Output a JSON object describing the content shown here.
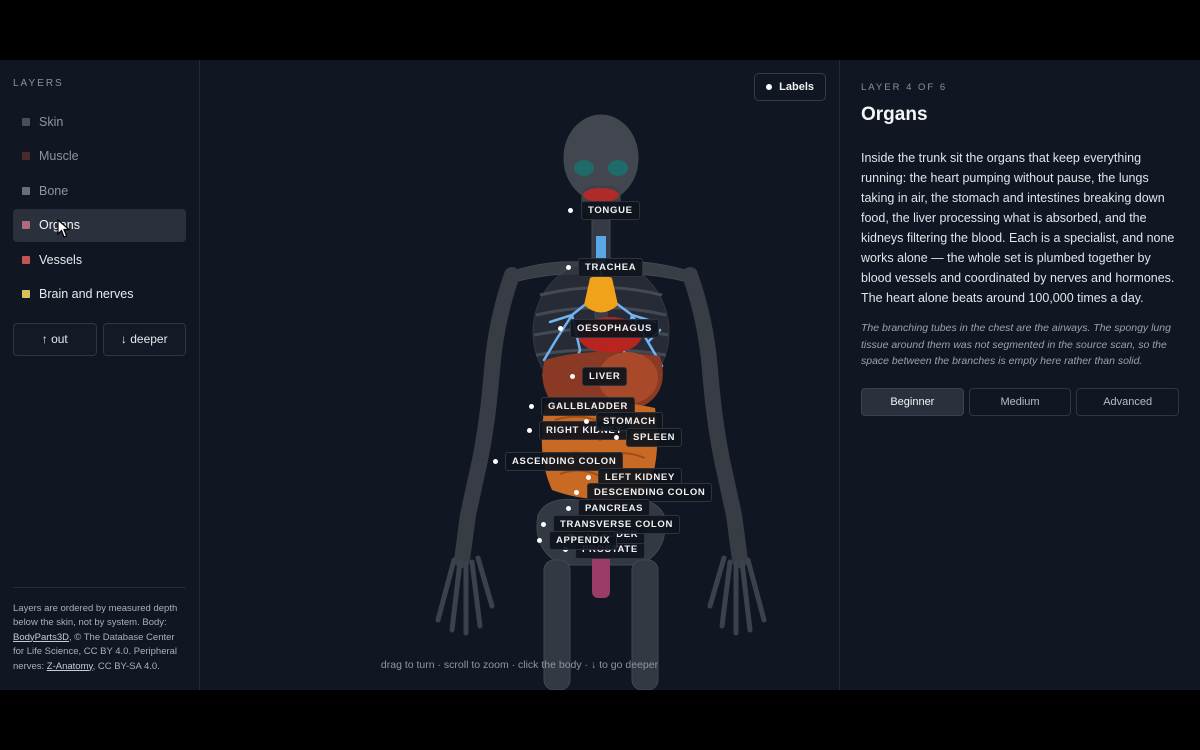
{
  "sidebar": {
    "title": "LAYERS",
    "layers": [
      {
        "label": "Skin",
        "color": "#4a4f57"
      },
      {
        "label": "Muscle",
        "color": "#4a2a2a"
      },
      {
        "label": "Bone",
        "color": "#6a6e75"
      },
      {
        "label": "Organs",
        "color": "#b06a7e"
      },
      {
        "label": "Vessels",
        "color": "#c25454"
      },
      {
        "label": "Brain and nerves",
        "color": "#d6c25a"
      }
    ],
    "out_label": "↑ out",
    "deeper_label": "↓ deeper",
    "footer": {
      "line1": "Layers are ordered by measured depth below the skin, not by system. Body: ",
      "link1": "BodyParts3D",
      "line2": ", © The Database Center for Life Science, CC BY 4.0. Peripheral nerves: ",
      "link2": "Z-Anatomy",
      "line3": ", CC BY-SA 4.0."
    }
  },
  "viewport": {
    "labels_button": "Labels",
    "hint": "drag to turn · scroll to zoom · click the body · ↓ to go deeper",
    "organ_labels": {
      "tongue": "TONGUE",
      "trachea": "TRACHEA",
      "oesophagus": "OESOPHAGUS",
      "liver": "LIVER",
      "gallbladder": "GALLBLADDER",
      "stomach": "STOMACH",
      "right_kidney": "RIGHT KIDNEY",
      "spleen": "SPLEEN",
      "ascending_colon": "ASCENDING COLON",
      "left_kidney": "LEFT KIDNEY",
      "descending_colon": "DESCENDING COLON",
      "pancreas": "PANCREAS",
      "transverse_colon": "TRANSVERSE COLON",
      "bladder": "BLADDER",
      "appendix": "APPENDIX",
      "prostate": "PROSTATE"
    }
  },
  "panel": {
    "step": "LAYER 4 OF 6",
    "title": "Organs",
    "body": "Inside the trunk sit the organs that keep everything running: the heart pumping without pause, the lungs taking in air, the stomach and intestines breaking down food, the liver processing what is absorbed, and the kidneys filtering the blood. Each is a specialist, and none works alone — the whole set is plumbed together by blood vessels and coordinated by nerves and hormones. The heart alone beats around 100,000 times a day.",
    "note": "The branching tubes in the chest are the airways. The spongy lung tissue around them was not segmented in the source scan, so the space between the branches is empty here rather than solid.",
    "levels": [
      "Beginner",
      "Medium",
      "Advanced"
    ]
  }
}
